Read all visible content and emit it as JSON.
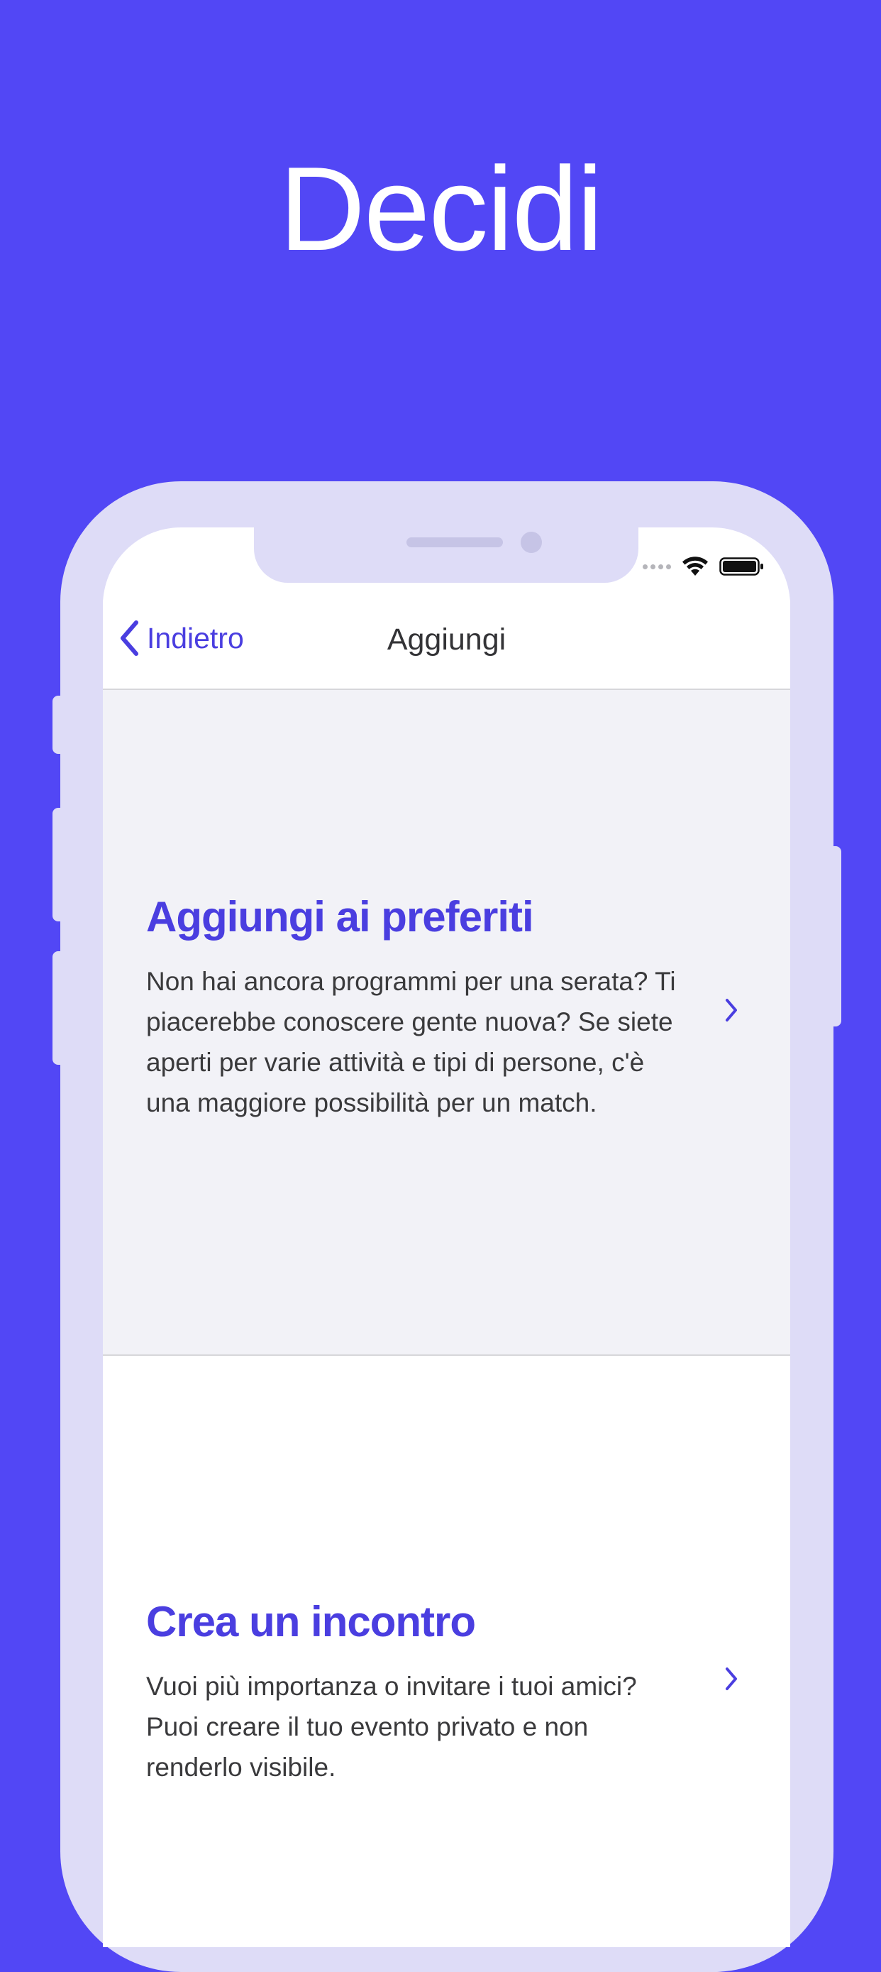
{
  "hero": {
    "title": "Decidi"
  },
  "nav": {
    "back_label": "Indietro",
    "title": "Aggiungi"
  },
  "cards": [
    {
      "title": "Aggiungi ai preferiti",
      "description": "Non hai ancora programmi per una serata? Ti piacerebbe conoscere gente nuova? Se siete aperti per varie attività e tipi di persone, c'è una maggiore possibilità per un match."
    },
    {
      "title": "Crea un incontro",
      "description": "Vuoi più importanza o invitare i tuoi amici? Puoi creare il tuo evento privato e non renderlo visibile."
    }
  ],
  "icons": {
    "back": "chevron-left-icon",
    "card_arrow": "chevron-right-icon",
    "wifi": "wifi-icon",
    "battery": "battery-icon",
    "signal": "signal-dots-icon"
  },
  "colors": {
    "background": "#5247F5",
    "accent": "#4A3EE0",
    "phone_frame": "#DEDCF7",
    "card_gray": "#F2F2F7"
  }
}
